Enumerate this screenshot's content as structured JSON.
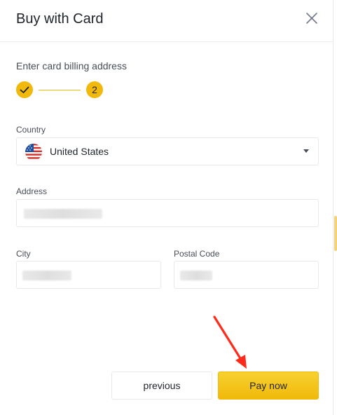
{
  "modal": {
    "title": "Buy with Card",
    "close_icon": "close-icon"
  },
  "step": {
    "instruction": "Enter card billing address",
    "completed_icon": "check-icon",
    "current_number": "2",
    "accent_color": "#f0b90b"
  },
  "form": {
    "country": {
      "label": "Country",
      "value": "United States",
      "flag_icon": "us-flag-icon",
      "dropdown_icon": "caret-down-icon"
    },
    "address": {
      "label": "Address",
      "value": ""
    },
    "city": {
      "label": "City",
      "value": ""
    },
    "postal_code": {
      "label": "Postal Code",
      "value": ""
    }
  },
  "actions": {
    "previous_label": "previous",
    "pay_label": "Pay now"
  },
  "annotation": {
    "arrow_icon": "red-arrow-icon",
    "arrow_color": "#ff2a1a"
  }
}
